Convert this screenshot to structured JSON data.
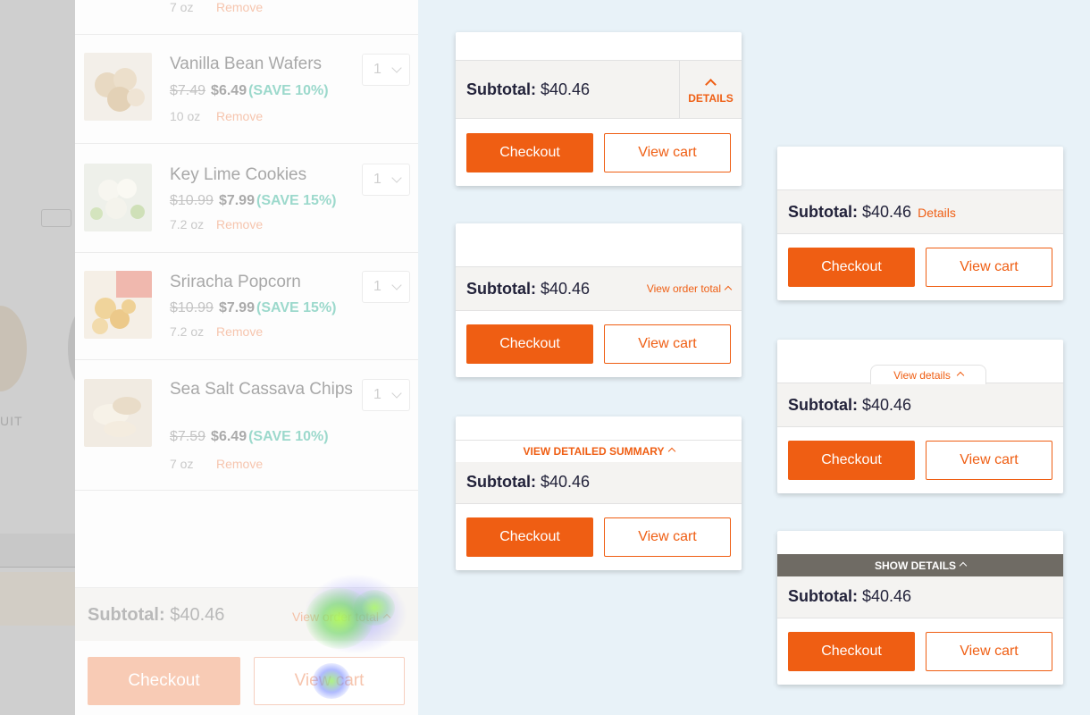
{
  "drawer": {
    "top_item": {
      "weight": "7 oz",
      "remove": "Remove"
    },
    "items": [
      {
        "name": "Vanilla Bean Wafers",
        "old_price": "$7.49",
        "new_price": "$6.49",
        "save": "(SAVE 10%)",
        "weight": "10 oz",
        "remove": "Remove",
        "qty": "1"
      },
      {
        "name": "Key Lime Cookies",
        "old_price": "$10.99",
        "new_price": "$7.99",
        "save": "(SAVE 15%)",
        "weight": "7.2 oz",
        "remove": "Remove",
        "qty": "1"
      },
      {
        "name": "Sriracha Popcorn",
        "old_price": "$10.99",
        "new_price": "$7.99",
        "save": "(SAVE 15%)",
        "weight": "7.2 oz",
        "remove": "Remove",
        "qty": "1"
      },
      {
        "name": "Sea Salt Cassava Chips",
        "old_price": "$7.59",
        "new_price": "$6.49",
        "save": "(SAVE 10%)",
        "weight": "7 oz",
        "remove": "Remove",
        "qty": "1"
      }
    ],
    "footer": {
      "subtotal_label": "Subtotal:",
      "subtotal_amount": "$40.46",
      "toggle_label": "View order total",
      "checkout": "Checkout",
      "view_cart": "View cart"
    }
  },
  "background": {
    "label": "UIT"
  },
  "variants": {
    "a": {
      "subtotal_label": "Subtotal:",
      "subtotal_amount": "$40.46",
      "toggle": "DETAILS",
      "checkout": "Checkout",
      "view_cart": "View cart"
    },
    "b": {
      "subtotal_label": "Subtotal:",
      "subtotal_amount": "$40.46",
      "toggle": "View order total",
      "checkout": "Checkout",
      "view_cart": "View cart"
    },
    "c": {
      "subtotal_label": "Subtotal:",
      "subtotal_amount": "$40.46",
      "toggle": "VIEW DETAILED SUMMARY",
      "checkout": "Checkout",
      "view_cart": "View cart"
    },
    "d": {
      "subtotal_label": "Subtotal:",
      "subtotal_amount": "$40.46",
      "toggle": "Details",
      "checkout": "Checkout",
      "view_cart": "View cart"
    },
    "e": {
      "subtotal_label": "Subtotal:",
      "subtotal_amount": "$40.46",
      "toggle": "View details",
      "checkout": "Checkout",
      "view_cart": "View cart"
    },
    "f": {
      "subtotal_label": "Subtotal:",
      "subtotal_amount": "$40.46",
      "toggle": "SHOW DETAILS",
      "checkout": "Checkout",
      "view_cart": "View cart"
    }
  },
  "colors": {
    "accent": "#ef5e13",
    "save_green": "#9cd9cc",
    "subtotal_bg": "#f4f3f1",
    "dark_tab": "#6f6b64",
    "page_bg": "#e8f2f8"
  }
}
